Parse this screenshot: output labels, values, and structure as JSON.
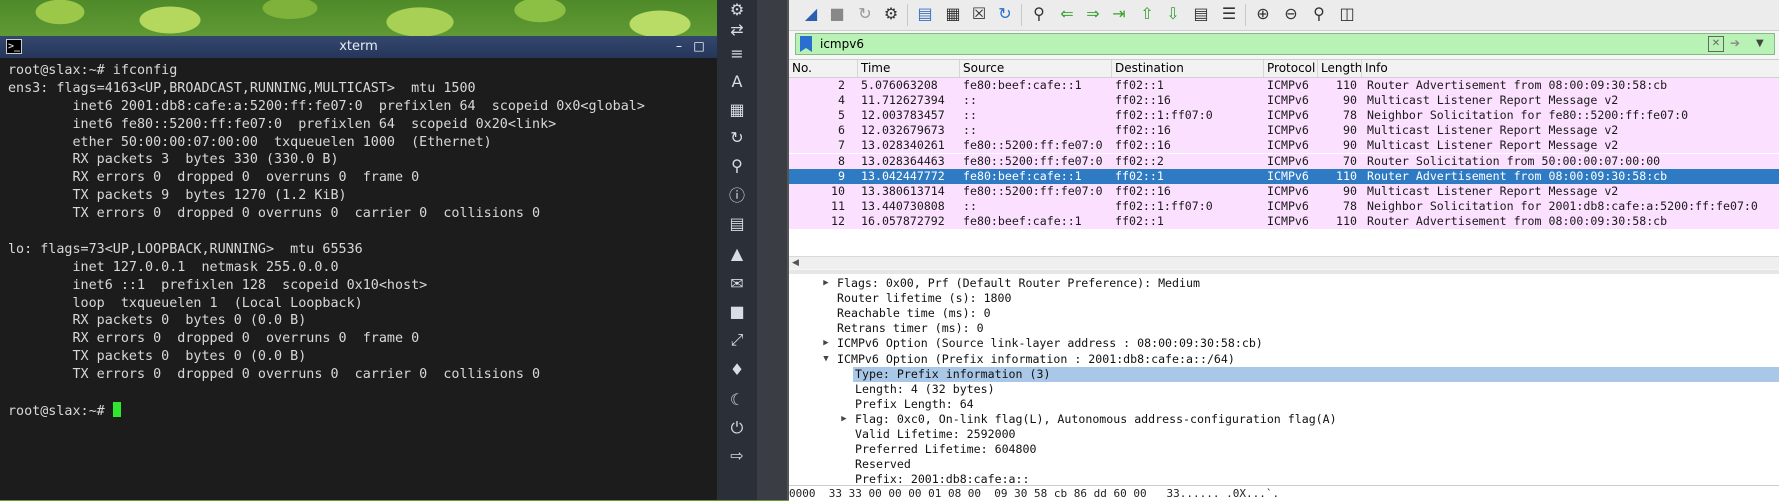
{
  "xterm": {
    "title": "xterm",
    "lines": [
      "root@slax:~# ifconfig",
      "ens3: flags=4163<UP,BROADCAST,RUNNING,MULTICAST>  mtu 1500",
      "        inet6 2001:db8:cafe:a:5200:ff:fe07:0  prefixlen 64  scopeid 0x0<global>",
      "        inet6 fe80::5200:ff:fe07:0  prefixlen 64  scopeid 0x20<link>",
      "        ether 50:00:00:07:00:00  txqueuelen 1000  (Ethernet)",
      "        RX packets 3  bytes 330 (330.0 B)",
      "        RX errors 0  dropped 0  overruns 0  frame 0",
      "        TX packets 9  bytes 1270 (1.2 KiB)",
      "        TX errors 0  dropped 0 overruns 0  carrier 0  collisions 0",
      "",
      "lo: flags=73<UP,LOOPBACK,RUNNING>  mtu 65536",
      "        inet 127.0.0.1  netmask 255.0.0.0",
      "        inet6 ::1  prefixlen 128  scopeid 0x10<host>",
      "        loop  txqueuelen 1  (Local Loopback)",
      "        RX packets 0  bytes 0 (0.0 B)",
      "        RX errors 0  dropped 0  overruns 0  frame 0",
      "        TX packets 0  bytes 0 (0.0 B)",
      "        TX errors 0  dropped 0 overruns 0  carrier 0  collisions 0",
      ""
    ],
    "prompt": "root@slax:~# ",
    "cursor_color": "#2ee62e"
  },
  "wireshark": {
    "filter": {
      "value": "icmpv6",
      "bg_color": "#b8f2b4"
    },
    "columns": [
      "No.",
      "Time",
      "Source",
      "Destination",
      "Protocol",
      "Length",
      "Info"
    ],
    "packets": [
      {
        "no": "2",
        "time": "5.076063208",
        "src": "fe80:beef:cafe::1",
        "dst": "ff02::1",
        "proto": "ICMPv6",
        "len": "110",
        "info": "Router Advertisement from 08:00:09:30:58:cb",
        "selected": false
      },
      {
        "no": "4",
        "time": "11.712627394",
        "src": "::",
        "dst": "ff02::16",
        "proto": "ICMPv6",
        "len": "90",
        "info": "Multicast Listener Report Message v2",
        "selected": false
      },
      {
        "no": "5",
        "time": "12.003783457",
        "src": "::",
        "dst": "ff02::1:ff07:0",
        "proto": "ICMPv6",
        "len": "78",
        "info": "Neighbor Solicitation for fe80::5200:ff:fe07:0",
        "selected": false
      },
      {
        "no": "6",
        "time": "12.032679673",
        "src": "::",
        "dst": "ff02::16",
        "proto": "ICMPv6",
        "len": "90",
        "info": "Multicast Listener Report Message v2",
        "selected": false
      },
      {
        "no": "7",
        "time": "13.028340261",
        "src": "fe80::5200:ff:fe07:0",
        "dst": "ff02::16",
        "proto": "ICMPv6",
        "len": "90",
        "info": "Multicast Listener Report Message v2",
        "selected": false
      },
      {
        "no": "8",
        "time": "13.028364463",
        "src": "fe80::5200:ff:fe07:0",
        "dst": "ff02::2",
        "proto": "ICMPv6",
        "len": "70",
        "info": "Router Solicitation from 50:00:00:07:00:00",
        "selected": false
      },
      {
        "no": "9",
        "time": "13.042447772",
        "src": "fe80:beef:cafe::1",
        "dst": "ff02::1",
        "proto": "ICMPv6",
        "len": "110",
        "info": "Router Advertisement from 08:00:09:30:58:cb",
        "selected": true
      },
      {
        "no": "10",
        "time": "13.380613714",
        "src": "fe80::5200:ff:fe07:0",
        "dst": "ff02::16",
        "proto": "ICMPv6",
        "len": "90",
        "info": "Multicast Listener Report Message v2",
        "selected": false
      },
      {
        "no": "11",
        "time": "13.440730808",
        "src": "::",
        "dst": "ff02::1:ff07:0",
        "proto": "ICMPv6",
        "len": "78",
        "info": "Neighbor Solicitation for 2001:db8:cafe:a:5200:ff:fe07:0",
        "selected": false
      },
      {
        "no": "12",
        "time": "16.057872792",
        "src": "fe80:beef:cafe::1",
        "dst": "ff02::1",
        "proto": "ICMPv6",
        "len": "110",
        "info": "Router Advertisement from 08:00:09:30:58:cb",
        "selected": false
      }
    ],
    "row_color": "#fce0ff",
    "selected_color": "#2e7bc4",
    "details": [
      {
        "text": "Flags: 0x00, Prf (Default Router Preference): Medium",
        "indent": 1,
        "toggle": "collapsed",
        "highlight": false
      },
      {
        "text": "Router lifetime (s): 1800",
        "indent": 1,
        "toggle": "none",
        "highlight": false
      },
      {
        "text": "Reachable time (ms): 0",
        "indent": 1,
        "toggle": "none",
        "highlight": false
      },
      {
        "text": "Retrans timer (ms): 0",
        "indent": 1,
        "toggle": "none",
        "highlight": false
      },
      {
        "text": "ICMPv6 Option (Source link-layer address : 08:00:09:30:58:cb)",
        "indent": 1,
        "toggle": "collapsed",
        "highlight": false
      },
      {
        "text": "ICMPv6 Option (Prefix information : 2001:db8:cafe:a::/64)",
        "indent": 1,
        "toggle": "expanded",
        "highlight": false
      },
      {
        "text": "Type: Prefix information (3)",
        "indent": 2,
        "toggle": "none",
        "highlight": true
      },
      {
        "text": "Length: 4 (32 bytes)",
        "indent": 2,
        "toggle": "none",
        "highlight": false
      },
      {
        "text": "Prefix Length: 64",
        "indent": 2,
        "toggle": "none",
        "highlight": false
      },
      {
        "text": "Flag: 0xc0, On-link flag(L), Autonomous address-configuration flag(A)",
        "indent": 2,
        "toggle": "collapsed",
        "highlight": false
      },
      {
        "text": "Valid Lifetime: 2592000",
        "indent": 2,
        "toggle": "none",
        "highlight": false
      },
      {
        "text": "Preferred Lifetime: 604800",
        "indent": 2,
        "toggle": "none",
        "highlight": false
      },
      {
        "text": "Reserved",
        "indent": 2,
        "toggle": "none",
        "highlight": false
      },
      {
        "text": "Prefix: 2001:db8:cafe:a::",
        "indent": 2,
        "toggle": "none",
        "highlight": false
      }
    ],
    "bytes_line": "0000  33 33 00 00 00 01 08 00  09 30 58 cb 86 dd 60 00   33...... .0X...`."
  }
}
